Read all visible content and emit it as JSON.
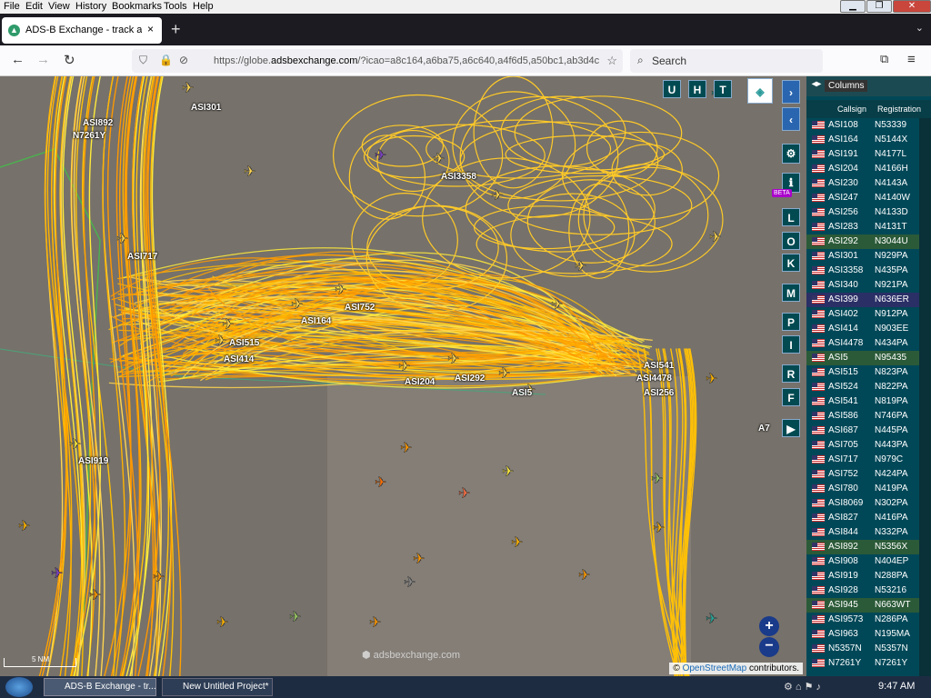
{
  "menu": [
    "File",
    "Edit",
    "View",
    "History",
    "Bookmarks",
    "Tools",
    "Help"
  ],
  "tab": {
    "title": "ADS-B Exchange - track aircraft",
    "close": "×"
  },
  "url": {
    "prefix": "https://globe.",
    "domain": "adsbexchange.com",
    "rest": "/?icao=a8c164,a6ba75,a6c640,a4f6d5,a50bc1,ab3d4c"
  },
  "search": {
    "placeholder": "Search"
  },
  "map_labels": [
    {
      "t": "ASI892"
    },
    {
      "t": "N7261Y"
    },
    {
      "t": "ASI301"
    },
    {
      "t": "ASI3358"
    },
    {
      "t": "ASI717"
    },
    {
      "t": "ASI752"
    },
    {
      "t": "ASI164"
    },
    {
      "t": "ASI515"
    },
    {
      "t": "ASI414"
    },
    {
      "t": "ASI204"
    },
    {
      "t": "ASI292"
    },
    {
      "t": "ASI5"
    },
    {
      "t": "ASI541"
    },
    {
      "t": "ASI256"
    },
    {
      "t": "ASI4478"
    },
    {
      "t": "ASI919"
    },
    {
      "t": "A7"
    }
  ],
  "map_buttons": {
    "u": "U",
    "h": "H",
    "t": "T",
    "l": "L",
    "o": "O",
    "k": "K",
    "m": "M",
    "p": "P",
    "i": "I",
    "r": "R",
    "f": "F",
    "beta": "BETA"
  },
  "scale": "5 NM",
  "watermark": "adsbexchange.com",
  "copyright": {
    "osm": "OpenStreetMap",
    "rest": " contributors."
  },
  "panel": {
    "title": "Columns",
    "col_callsign": "Callsign",
    "col_reg": "Registration"
  },
  "rows": [
    {
      "c": "ASI108",
      "r": "N53339"
    },
    {
      "c": "ASI164",
      "r": "N5144X"
    },
    {
      "c": "ASI191",
      "r": "N4177L"
    },
    {
      "c": "ASI204",
      "r": "N4166H"
    },
    {
      "c": "ASI230",
      "r": "N4143A"
    },
    {
      "c": "ASI247",
      "r": "N4140W"
    },
    {
      "c": "ASI256",
      "r": "N4133D"
    },
    {
      "c": "ASI283",
      "r": "N4131T"
    },
    {
      "c": "ASI292",
      "r": "N3044U"
    },
    {
      "c": "ASI301",
      "r": "N929PA"
    },
    {
      "c": "ASI3358",
      "r": "N435PA"
    },
    {
      "c": "ASI340",
      "r": "N921PA"
    },
    {
      "c": "ASI399",
      "r": "N636ER"
    },
    {
      "c": "ASI402",
      "r": "N912PA"
    },
    {
      "c": "ASI414",
      "r": "N903EE"
    },
    {
      "c": "ASI4478",
      "r": "N434PA"
    },
    {
      "c": "ASI5",
      "r": "N95435"
    },
    {
      "c": "ASI515",
      "r": "N823PA"
    },
    {
      "c": "ASI524",
      "r": "N822PA"
    },
    {
      "c": "ASI541",
      "r": "N819PA"
    },
    {
      "c": "ASI586",
      "r": "N746PA"
    },
    {
      "c": "ASI687",
      "r": "N445PA"
    },
    {
      "c": "ASI705",
      "r": "N443PA"
    },
    {
      "c": "ASI717",
      "r": "N979C"
    },
    {
      "c": "ASI752",
      "r": "N424PA"
    },
    {
      "c": "ASI780",
      "r": "N419PA"
    },
    {
      "c": "ASI8069",
      "r": "N302PA"
    },
    {
      "c": "ASI827",
      "r": "N416PA"
    },
    {
      "c": "ASI844",
      "r": "N332PA"
    },
    {
      "c": "ASI892",
      "r": "N5356X"
    },
    {
      "c": "ASI908",
      "r": "N404EP"
    },
    {
      "c": "ASI919",
      "r": "N288PA"
    },
    {
      "c": "ASI928",
      "r": "N53216"
    },
    {
      "c": "ASI945",
      "r": "N663WT"
    },
    {
      "c": "ASI9573",
      "r": "N286PA"
    },
    {
      "c": "ASI963",
      "r": "N195MA"
    },
    {
      "c": "N5357N",
      "r": "N5357N"
    },
    {
      "c": "N7261Y",
      "r": "N7261Y"
    }
  ],
  "taskbar": {
    "item1": "ADS-B Exchange - tr...",
    "item2": "New Untitled Project*",
    "time": "9:47 AM"
  }
}
